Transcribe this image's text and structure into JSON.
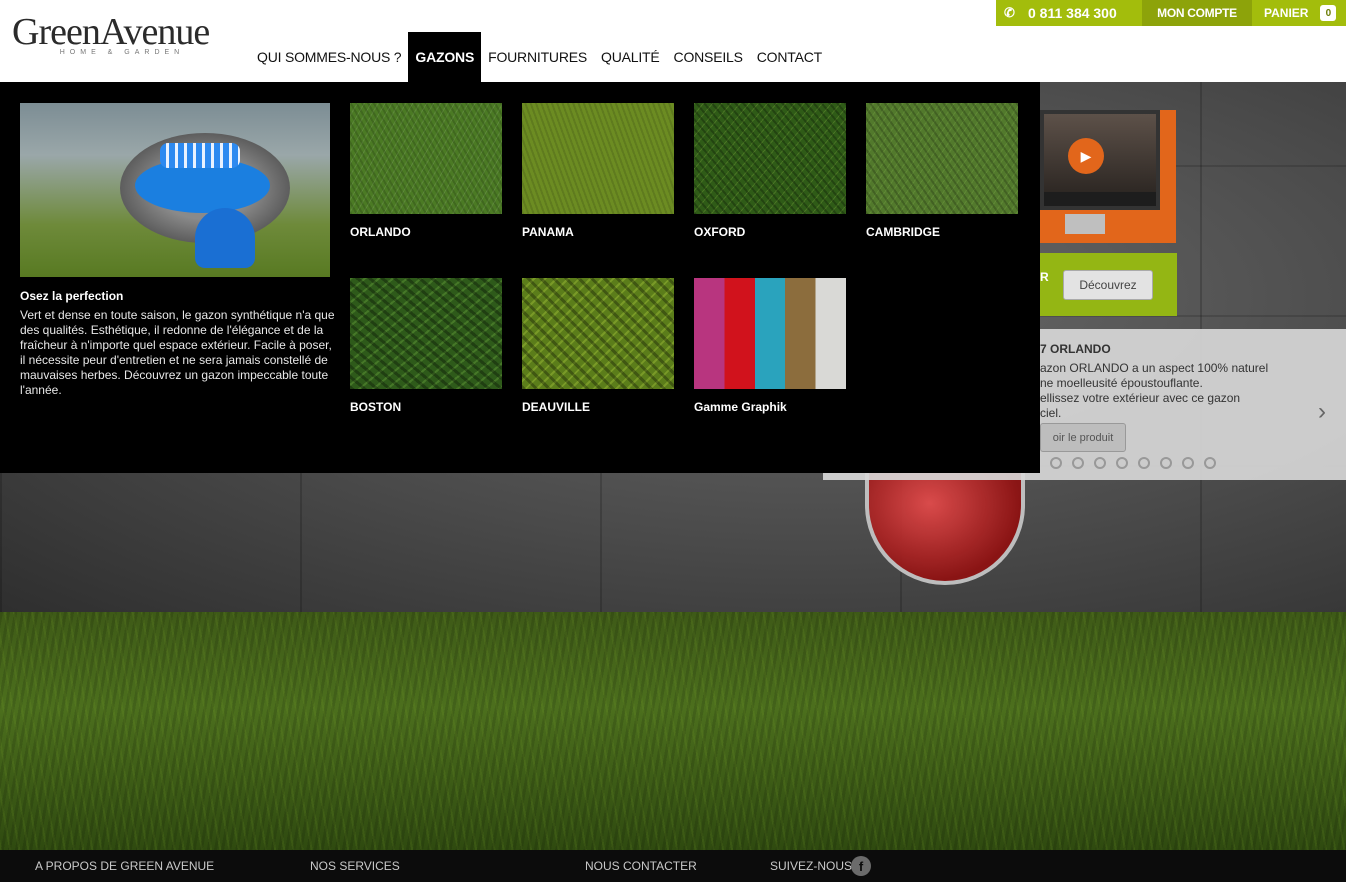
{
  "header": {
    "logo_main": "GreenAvenue",
    "logo_sub": "HOME & GARDEN",
    "nav": [
      "QUI SOMMES-NOUS ?",
      "GAZONS",
      "FOURNITURES",
      "QUALITÉ",
      "CONSEILS",
      "CONTACT"
    ],
    "active_nav": "GAZONS"
  },
  "topbar": {
    "phone": "0 811 384 300",
    "phone_icon": "phone-icon",
    "account": "MON COMPTE",
    "cart": "PANIER",
    "cart_count": "0",
    "cart_icon": "bag-icon",
    "accent_color": "#a3bd0c"
  },
  "mega_menu": {
    "featured_title": "Osez la perfection",
    "featured_text": "Vert et dense en toute saison, le gazon synthétique n'a que des qualités. Esthétique, il redonne de l'élégance et de la fraîcheur à n'importe quel espace extérieur. Facile à poser, il nécessite peur d'entretien et ne sera jamais constellé de mauvaises herbes. Découvrez un gazon impeccable toute l'année.",
    "products": [
      "ORLANDO",
      "PANAMA",
      "OXFORD",
      "CAMBRIDGE",
      "BOSTON",
      "DEAUVILLE",
      "Gamme Graphik"
    ]
  },
  "promo": {
    "green_letter": "R",
    "button": "Découvrez",
    "play_icon": "play-icon"
  },
  "slider": {
    "title": "7 ORLANDO",
    "line1": "azon ORLANDO a un aspect 100% naturel",
    "line2": "ne moelleusité époustouflante.",
    "line3": "ellissez votre extérieur avec ce gazon",
    "line4": "ciel.",
    "button": "oir le produit",
    "next_icon": "chevron-right-icon",
    "dots": 8
  },
  "footer": {
    "items": [
      "A PROPOS DE GREEN AVENUE",
      "NOS SERVICES",
      "NOUS CONTACTER",
      "SUIVEZ-NOUS"
    ],
    "social_icon": "facebook-icon"
  }
}
